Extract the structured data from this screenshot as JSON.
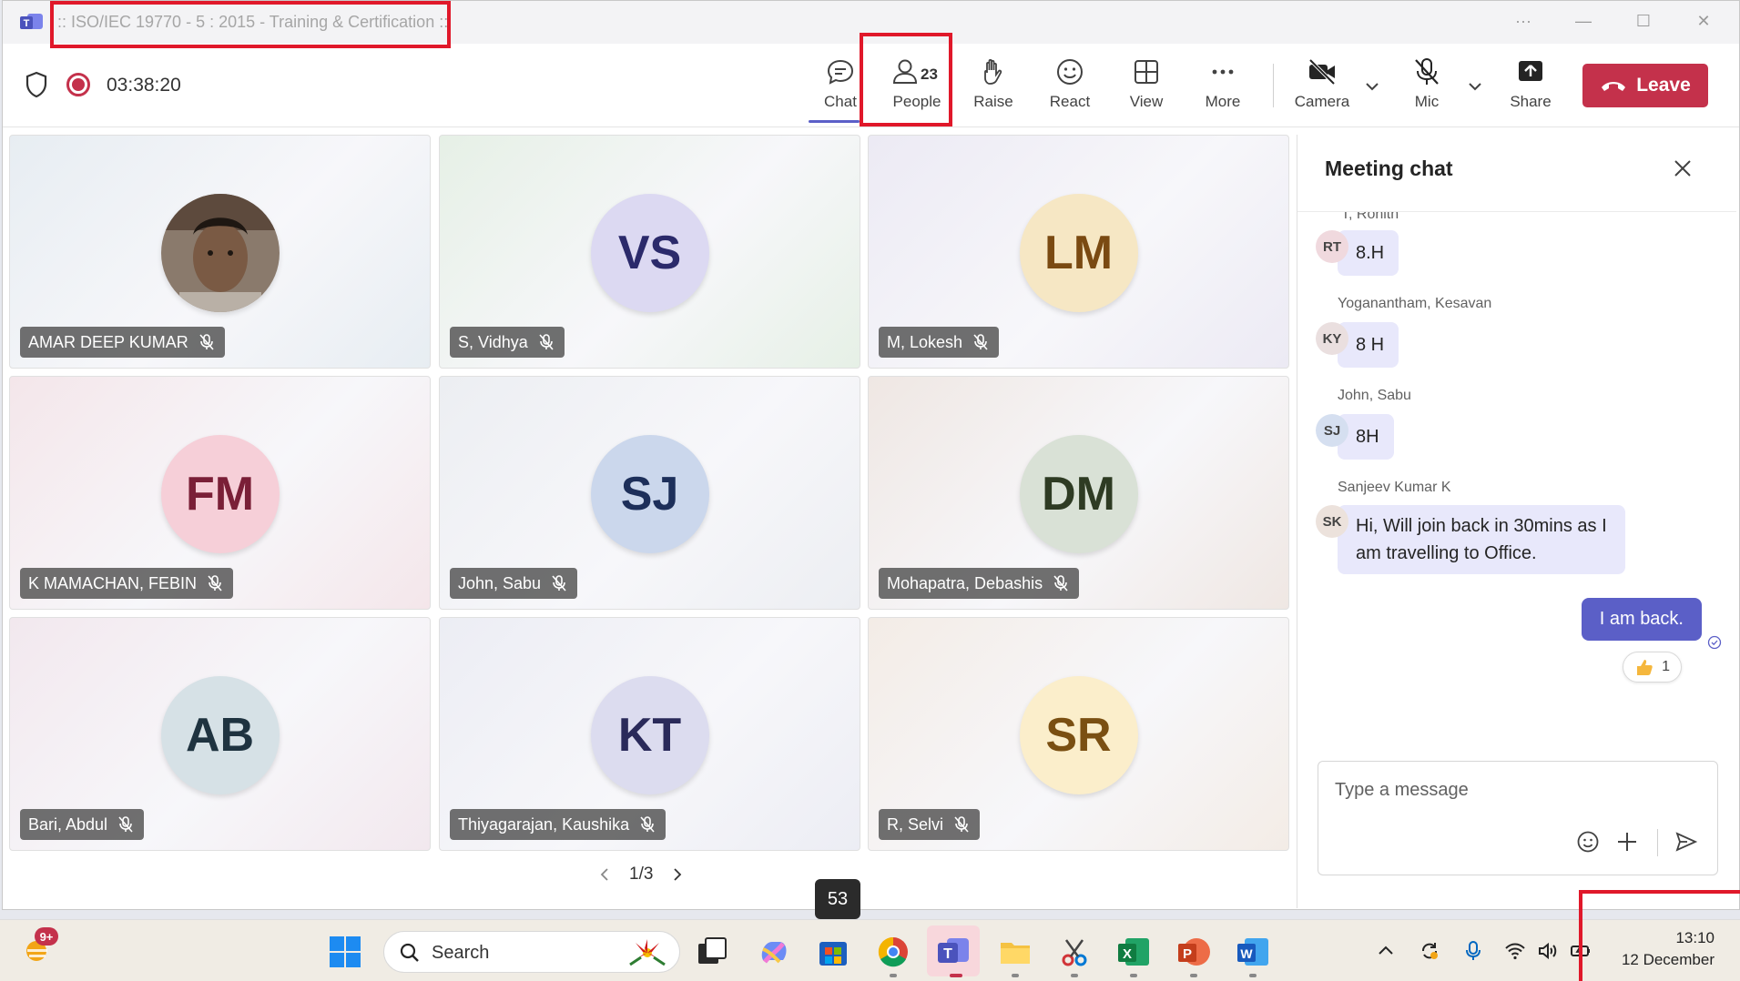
{
  "window": {
    "title": ":: ISO/IEC 19770 - 5 : 2015 - Training & Certification ::",
    "controls": [
      "···",
      "—",
      "☐",
      "✕"
    ]
  },
  "meeting": {
    "timer": "03:38:20"
  },
  "toolbar": {
    "chat": "Chat",
    "people": "People",
    "people_count": "23",
    "raise": "Raise",
    "react": "React",
    "view": "View",
    "more": "More",
    "camera": "Camera",
    "mic": "Mic",
    "share": "Share",
    "leave": "Leave"
  },
  "participants": [
    {
      "name": "AMAR DEEP KUMAR",
      "initials": "",
      "photo": true,
      "bg": "#e7edf2",
      "avatar_bg": "#6b5a4e",
      "fg": "#000000"
    },
    {
      "name": "S, Vidhya",
      "initials": "VS",
      "bg": "#e6f0e6",
      "avatar_bg": "#dcd9f2",
      "fg": "#2b2a6b"
    },
    {
      "name": "M, Lokesh",
      "initials": "LM",
      "bg": "#eceaf4",
      "avatar_bg": "#f6e7c4",
      "fg": "#7a4a12"
    },
    {
      "name": "K MAMACHAN, FEBIN",
      "initials": "FM",
      "bg": "#f4e6ea",
      "avatar_bg": "#f6cfd8",
      "fg": "#7a1f37"
    },
    {
      "name": "John, Sabu",
      "initials": "SJ",
      "bg": "#eceef2",
      "avatar_bg": "#cbd7ec",
      "fg": "#1d2f5a"
    },
    {
      "name": "Mohapatra, Debashis",
      "initials": "DM",
      "bg": "#efe7e3",
      "avatar_bg": "#d9e1d6",
      "fg": "#2e3b23"
    },
    {
      "name": "Bari, Abdul",
      "initials": "AB",
      "bg": "#f2e8ee",
      "avatar_bg": "#d6e1e6",
      "fg": "#1f3340"
    },
    {
      "name": "Thiyagarajan, Kaushika",
      "initials": "KT",
      "bg": "#ecedf4",
      "avatar_bg": "#dcdcef",
      "fg": "#2a2a5a"
    },
    {
      "name": "R, Selvi",
      "initials": "SR",
      "bg": "#f3ece6",
      "avatar_bg": "#fbeecb",
      "fg": "#7a4f12"
    }
  ],
  "pager": {
    "label": "1/3"
  },
  "chat": {
    "title": "Meeting chat",
    "messages": [
      {
        "sender": "T, Rohith",
        "initials": "RT",
        "text": "8.H",
        "avatar_bg": "#f0d9de"
      },
      {
        "sender": "Yoganantham, Kesavan",
        "initials": "KY",
        "text": "8 H",
        "avatar_bg": "#eadfdf"
      },
      {
        "sender": "John, Sabu",
        "initials": "SJ",
        "text": "8H",
        "avatar_bg": "#d5dff0"
      },
      {
        "sender": "Sanjeev Kumar K",
        "initials": "SK",
        "text_line1": "Hi,  Will join back in 30mins as I",
        "text_line2": "am travelling to Office.",
        "avatar_bg": "#ece2dc"
      }
    ],
    "my_message": "I am back.",
    "reaction_count": "1",
    "compose_placeholder": "Type a message"
  },
  "tooltip": "53",
  "taskbar": {
    "badge": "9+",
    "search_label": "Search",
    "time": "13:10",
    "date": "12 December"
  },
  "colors": {
    "accent": "#5b5fc7",
    "leave": "#c4314b",
    "highlight_box": "#e0182a"
  }
}
